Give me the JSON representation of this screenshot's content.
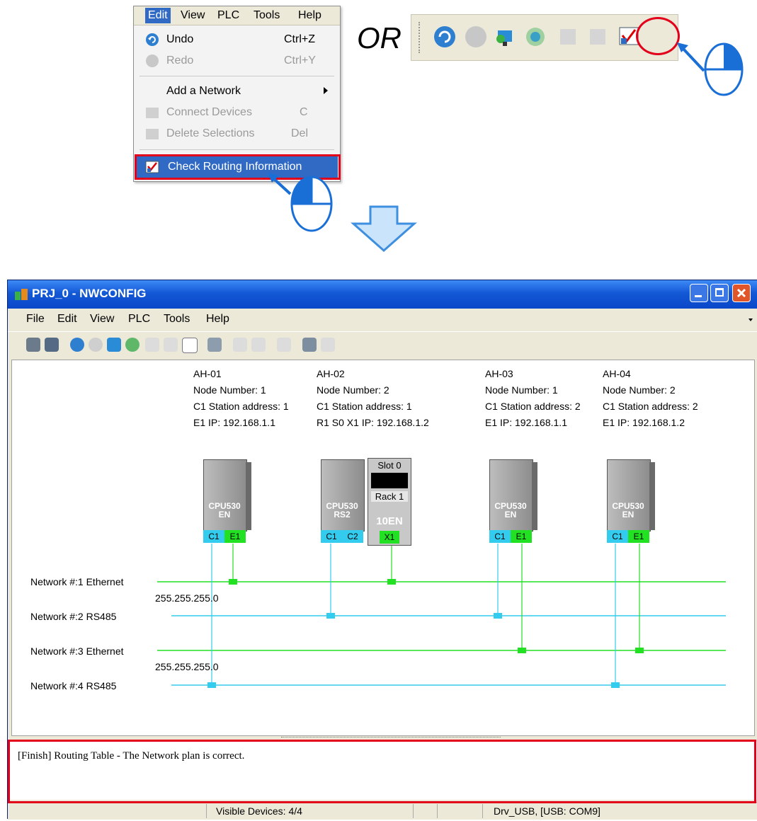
{
  "edit_menu": {
    "bar": [
      "Edit",
      "View",
      "PLC",
      "Tools",
      "Help"
    ],
    "items": [
      {
        "label": "Undo",
        "shortcut": "Ctrl+Z",
        "enabled": true
      },
      {
        "label": "Redo",
        "shortcut": "Ctrl+Y",
        "enabled": false
      },
      {
        "label": "Add a Network",
        "shortcut": "",
        "enabled": true
      },
      {
        "label": "Connect Devices",
        "shortcut": "C",
        "enabled": false
      },
      {
        "label": "Delete Selections",
        "shortcut": "Del",
        "enabled": false
      },
      {
        "label": "Check Routing Information",
        "shortcut": "",
        "enabled": true
      }
    ]
  },
  "or_text": "OR",
  "window": {
    "title": "PRJ_0 - NWCONFIG",
    "menu": [
      "File",
      "Edit",
      "View",
      "PLC",
      "Tools",
      "Help"
    ]
  },
  "devices": [
    {
      "name": "AH-01",
      "node": "Node Number: 1",
      "c1": "C1 Station address: 1",
      "ip": "E1 IP: 192.168.1.1",
      "model": "CPU530",
      "sub": "EN",
      "ports": [
        "C1",
        "E1"
      ]
    },
    {
      "name": "AH-02",
      "node": "Node Number: 2",
      "c1": "C1 Station address: 1",
      "ip": "R1 S0 X1 IP: 192.168.1.2",
      "model": "CPU530",
      "sub": "RS2",
      "ports": [
        "C1",
        "C2"
      ],
      "rack": {
        "slot": "Slot 0",
        "rack": "Rack 1",
        "module": "10EN",
        "port": "X1"
      }
    },
    {
      "name": "AH-03",
      "node": "Node Number: 1",
      "c1": "C1 Station address: 2",
      "ip": "E1 IP: 192.168.1.1",
      "model": "CPU530",
      "sub": "EN",
      "ports": [
        "C1",
        "E1"
      ]
    },
    {
      "name": "AH-04",
      "node": "Node Number: 2",
      "c1": "C1 Station address: 2",
      "ip": "E1 IP: 192.168.1.2",
      "model": "CPU530",
      "sub": "EN",
      "ports": [
        "C1",
        "E1"
      ]
    }
  ],
  "networks": [
    {
      "label": "Network #:1  Ethernet",
      "mask": "255.255.255.0",
      "color": "#22e022"
    },
    {
      "label": "Network #:2  RS485",
      "mask": "",
      "color": "#33ccee"
    },
    {
      "label": "Network #:3  Ethernet",
      "mask": "255.255.255.0",
      "color": "#22e022"
    },
    {
      "label": "Network #:4  RS485",
      "mask": "",
      "color": "#33ccee"
    }
  ],
  "output": "[Finish] Routing Table - The Network plan is correct.",
  "status": {
    "devices": "Visible Devices: 4/4",
    "driver": "Drv_USB, [USB: COM9]"
  },
  "colors": {
    "highlight": "#e2001a",
    "arrow": "#1a6fd6",
    "ethernet": "#22e022",
    "rs485": "#33ccee"
  }
}
